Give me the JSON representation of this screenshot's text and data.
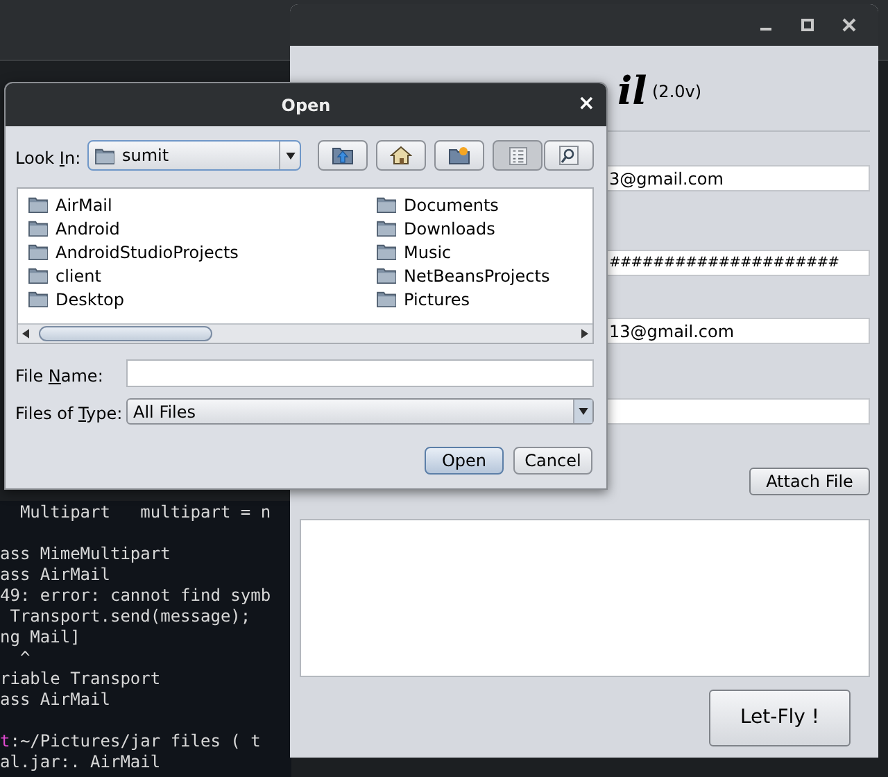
{
  "terminal": {
    "lines": [
      {
        "text": "  Multipart   multipart = n"
      },
      {
        "text": "ass MimeMultipart",
        "blank_before": true
      },
      {
        "text": "ass AirMail"
      },
      {
        "text": "49: error: cannot find symb"
      },
      {
        "text": " Transport.send(message);"
      },
      {
        "text": "ng Mail]"
      },
      {
        "text": "  ^"
      },
      {
        "text": "riable Transport"
      },
      {
        "text": "ass AirMail"
      },
      {
        "prompt": "t",
        "text": ":~/Pictures/jar files ( t",
        "blank_before": true
      },
      {
        "text": "al.jar:. AirMail"
      }
    ]
  },
  "airmail_window": {
    "logo": "il",
    "version": "(2.0v)",
    "fields": [
      {
        "kind": "text",
        "value": "3@gmail.com"
      },
      {
        "kind": "password",
        "value": "#####################"
      },
      {
        "kind": "text",
        "value": "13@gmail.com"
      },
      {
        "kind": "text"
      }
    ],
    "attach_button": "Attach File",
    "send_button": "Let-Fly !"
  },
  "open_dialog": {
    "title": "Open",
    "close": "×",
    "look_in": {
      "label": [
        "Look ",
        "I",
        "n:"
      ],
      "value": "sumit"
    },
    "toolbar": [
      {
        "kind": "up",
        "selected": false
      },
      {
        "kind": "home",
        "selected": false
      },
      {
        "kind": "newfolder",
        "selected": false
      },
      {
        "kind": "list",
        "selected": true
      },
      {
        "kind": "details",
        "selected": false
      }
    ],
    "columns": [
      [
        "AirMail",
        "Android",
        "AndroidStudioProjects",
        "client",
        "Desktop"
      ],
      [
        "Documents",
        "Downloads",
        "Music",
        "NetBeansProjects",
        "Pictures"
      ]
    ],
    "file_name": {
      "label": [
        "File ",
        "N",
        "ame:"
      ]
    },
    "file_type": {
      "label": [
        "Files of ",
        "T",
        "ype:"
      ],
      "value": "All Files"
    },
    "buttons": [
      {
        "label": "Open",
        "default": true
      },
      {
        "label": "Cancel",
        "default": false
      }
    ]
  }
}
